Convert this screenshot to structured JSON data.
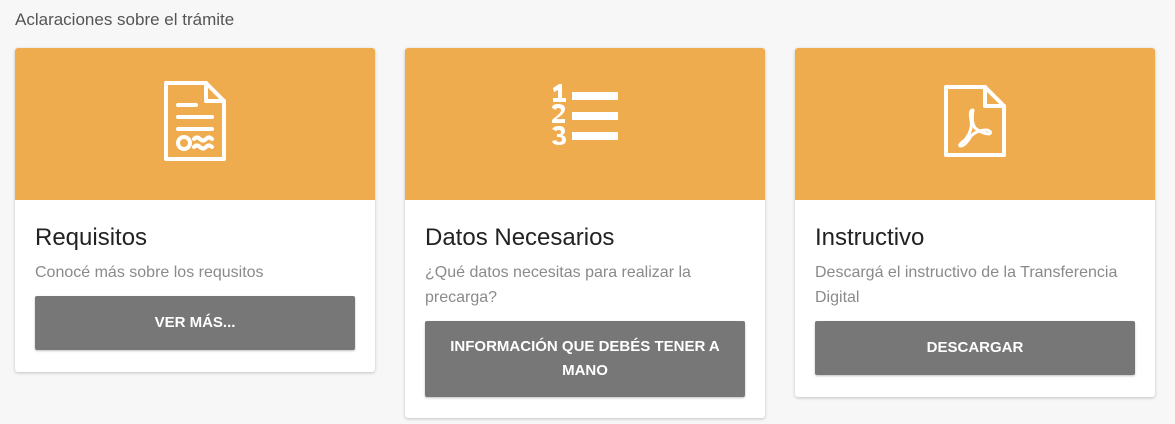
{
  "section": {
    "title": "Aclaraciones sobre el trámite"
  },
  "cards": [
    {
      "icon": "document-certificate-icon",
      "title": "Requisitos",
      "description": "Conocé más sobre los requsitos",
      "button_label": "VER MÁS..."
    },
    {
      "icon": "numbered-list-icon",
      "title": "Datos Necesarios",
      "description": "¿Qué datos necesitas para realizar la precarga?",
      "button_label": "INFORMACIÓN QUE DEBÉS TENER A MANO"
    },
    {
      "icon": "pdf-file-icon",
      "title": "Instructivo",
      "description": "Descargá el instructivo de la Transferencia Digital",
      "button_label": "DESCARGAR"
    }
  ],
  "colors": {
    "header_bg": "#efac4e",
    "button_bg": "#777777",
    "page_bg": "#f7f7f7"
  }
}
